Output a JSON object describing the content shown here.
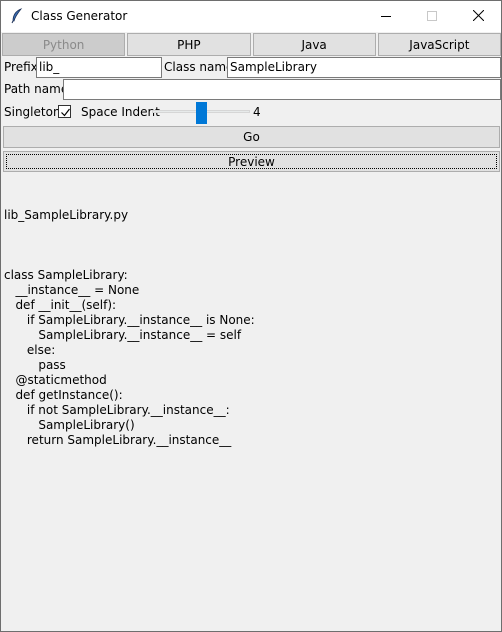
{
  "window": {
    "title": "Class Generator",
    "icon": "feather-icon",
    "controls": [
      "minimize-icon",
      "maximize-icon",
      "close-icon"
    ]
  },
  "tabs": [
    {
      "label": "Python",
      "active": true
    },
    {
      "label": "PHP",
      "active": false
    },
    {
      "label": "Java",
      "active": false
    },
    {
      "label": "JavaScript",
      "active": false
    }
  ],
  "form": {
    "prefix_label": "Prefix",
    "prefix_value": "lib_",
    "class_name_label": "Class name",
    "class_name_value": "SampleLibrary",
    "path_name_label": "Path name",
    "path_name_value": "",
    "singleton_label": "Singleton",
    "singleton_checked": true,
    "space_indent_label": "Space Indent",
    "space_indent_value": "4",
    "space_indent_fraction": 0.5
  },
  "buttons": {
    "go_label": "Go",
    "preview_label": "Preview"
  },
  "preview": {
    "filename": "lib_SampleLibrary.py",
    "lines": [
      "",
      "class SampleLibrary:",
      "    __instance__ = None",
      "    def __init__(self):",
      "        if SampleLibrary.__instance__ is None:",
      "            SampleLibrary.__instance__ = self",
      "        else:",
      "            pass",
      "    @staticmethod",
      "    def getInstance():",
      "        if not SampleLibrary.__instance__:",
      "            SampleLibrary()",
      "        return SampleLibrary.__instance__"
    ]
  },
  "colors": {
    "accent": "#0078d7",
    "background": "#f0f0f0",
    "button": "#e1e1e1",
    "active_tab": "#cccccc"
  }
}
